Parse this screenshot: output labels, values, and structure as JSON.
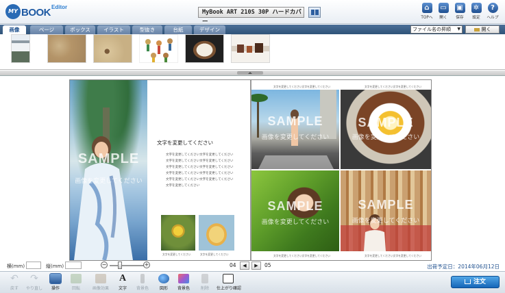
{
  "app": {
    "logo_my": "MY",
    "logo_book": "BOOK",
    "logo_editor": "Editor",
    "book_title": "MyBook ART 210S 30P ハードカバー"
  },
  "header_tools": [
    {
      "label": "TOPへ",
      "icon": "home-icon"
    },
    {
      "label": "開く",
      "icon": "open-icon"
    },
    {
      "label": "保存",
      "icon": "save-icon"
    },
    {
      "label": "設定",
      "icon": "gear-icon"
    },
    {
      "label": "ヘルプ",
      "icon": "help-icon"
    }
  ],
  "tabs": [
    {
      "label": "画像",
      "active": true
    },
    {
      "label": "ページ",
      "active": false
    },
    {
      "label": "ボックス",
      "active": false
    },
    {
      "label": "イラスト",
      "active": false
    },
    {
      "label": "型抜き",
      "active": false
    },
    {
      "label": "台紙",
      "active": false
    },
    {
      "label": "デザイン台紙",
      "active": false
    }
  ],
  "sort_select": {
    "value": "ファイル名の昇順"
  },
  "open_button": {
    "label": "開く"
  },
  "spread": {
    "sample_text": "SAMPLE",
    "sample_sub": "画像を変更してください",
    "heading": "文字を変更してください",
    "body_lines": [
      "文字を変更してください文字を変更してください",
      "文字を変更してください文字を変更してください",
      "文字を変更してください文字を変更してください",
      "文字を変更してください文字を変更してください",
      "文字を変更してください文字を変更してください",
      "文字を変更してください"
    ],
    "caption": "文字を変更してください文字を変更してください",
    "caption_short": "文字を変更してください"
  },
  "info_bar": {
    "width_label": "横(mm)",
    "height_label": "縦(mm)",
    "left_page": "04",
    "right_page": "05",
    "publish_date": "出荷予定日：2014年06月12日"
  },
  "toolbar": [
    {
      "label": "戻す",
      "enabled": false
    },
    {
      "label": "やり直し",
      "enabled": false
    },
    {
      "label": "操作",
      "enabled": true
    },
    {
      "label": "回転",
      "enabled": false
    },
    {
      "label": "画像効果",
      "enabled": false
    },
    {
      "label": "文字",
      "enabled": true
    },
    {
      "label": "背景色",
      "enabled": false
    },
    {
      "label": "図形",
      "enabled": true
    },
    {
      "label": "背景色",
      "enabled": true
    },
    {
      "label": "削除",
      "enabled": false
    },
    {
      "label": "仕上がり確認",
      "enabled": true
    }
  ],
  "order_button": {
    "label": "注文"
  },
  "colors": {
    "brand_blue": "#1f5aa3",
    "tab_bar": "#3b5f87",
    "order_button": "#1a6fc0"
  }
}
